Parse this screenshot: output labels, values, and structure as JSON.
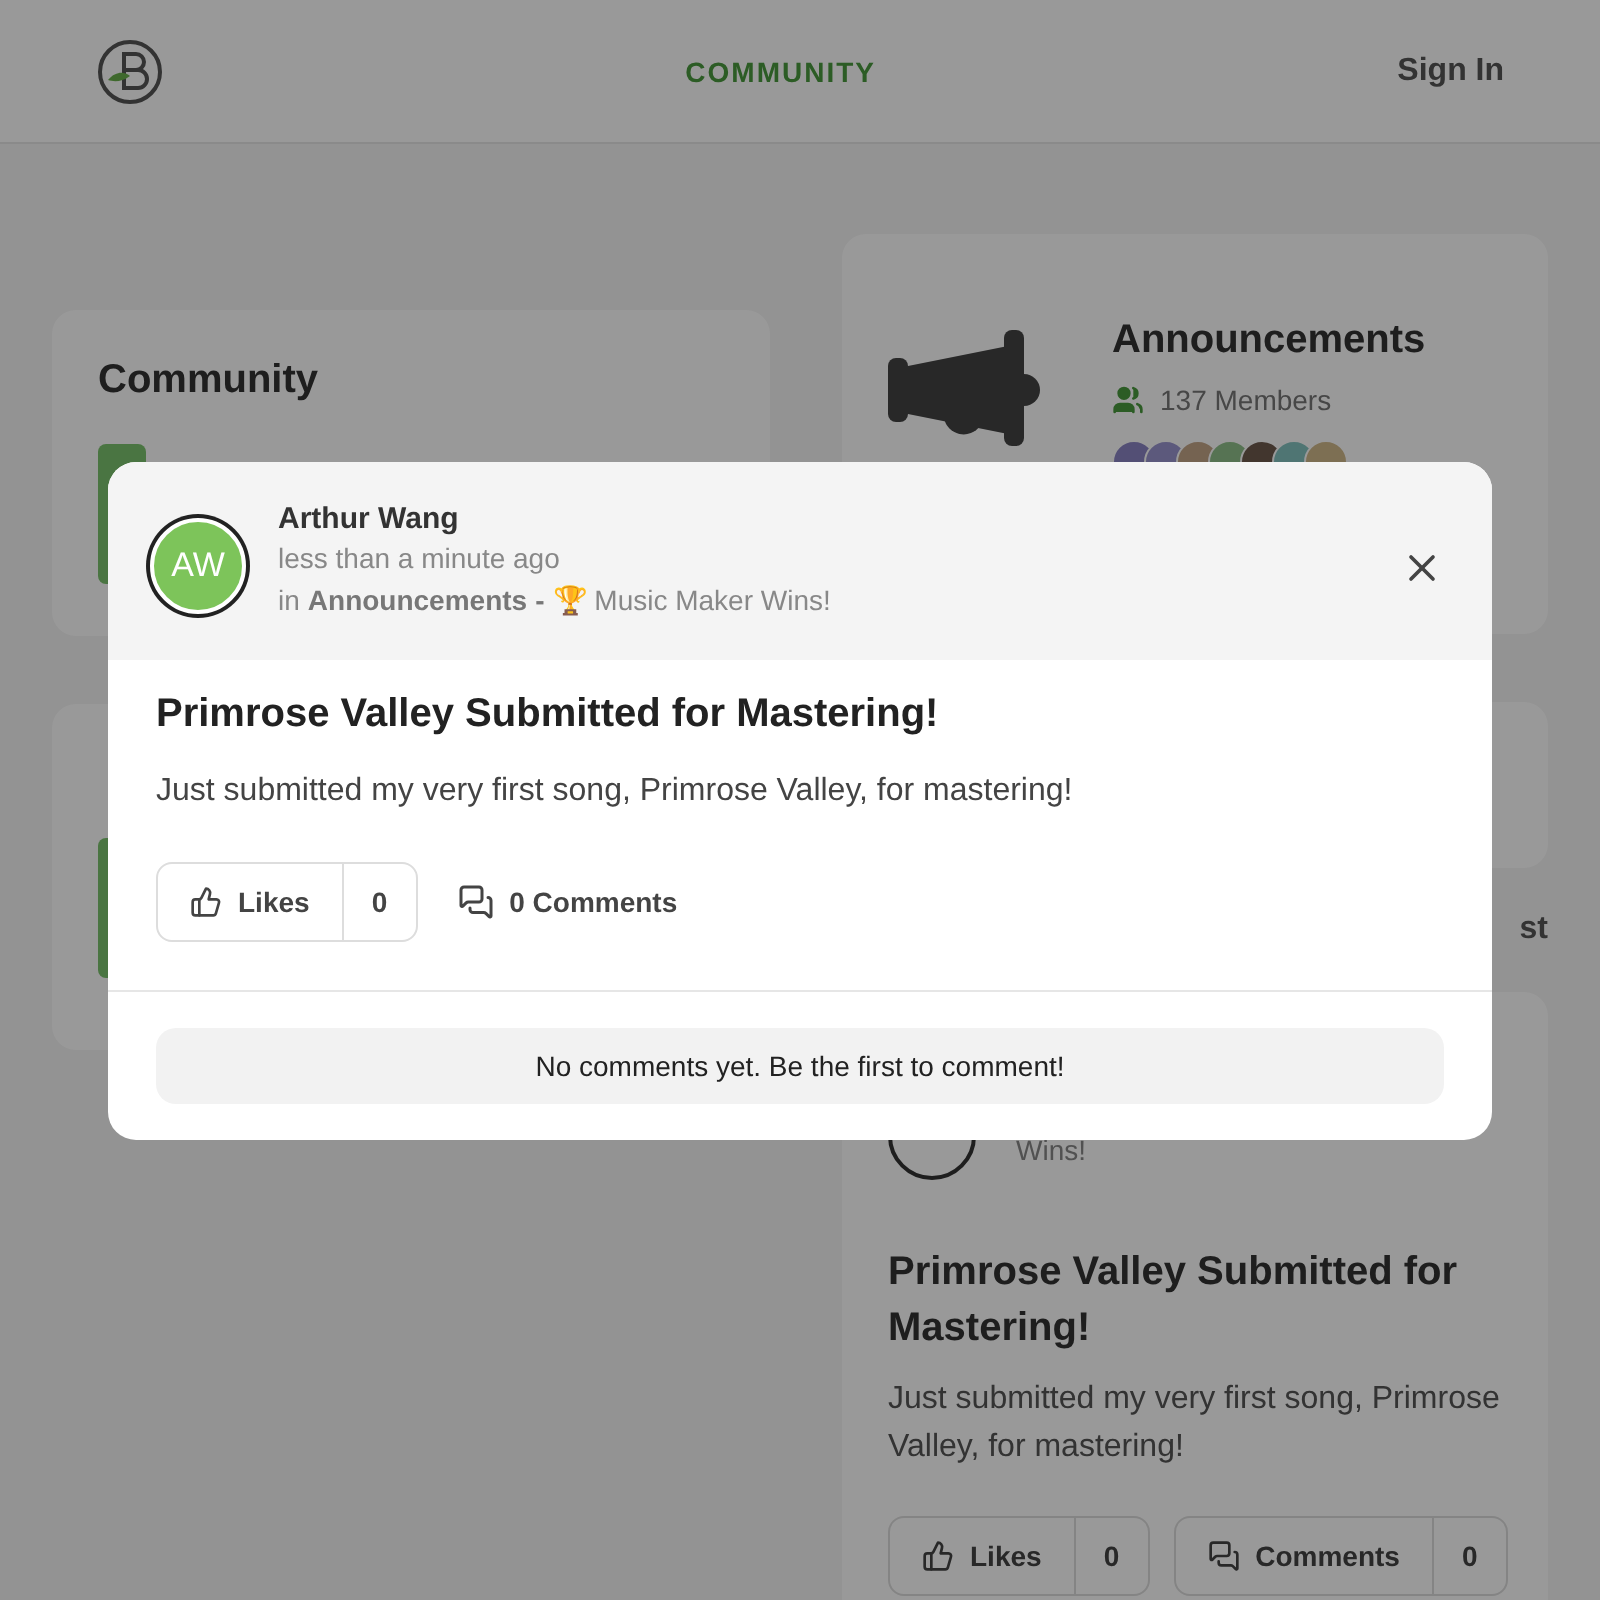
{
  "header": {
    "nav": "COMMUNITY",
    "sign_in": "Sign In"
  },
  "community_card": {
    "title": "Community"
  },
  "group": {
    "title": "Announcements",
    "members": "137 Members"
  },
  "tab_fragment": "st",
  "feed_post": {
    "meta": "Wins!",
    "title": "Primrose Valley Submitted for Mastering!",
    "body": "Just submitted my very first song, Primrose Valley, for mastering!",
    "likes_label": "Likes",
    "likes_count": "0",
    "comments_label": "Comments",
    "comments_count": "0"
  },
  "modal": {
    "initials": "AW",
    "author": "Arthur Wang",
    "time": "less than a minute ago",
    "in_prefix": "in",
    "group": "Announcements",
    "separator": "-",
    "topic": "🏆 Music Maker Wins!",
    "title": "Primrose Valley Submitted for Mastering!",
    "body": "Just submitted my very first song, Primrose Valley, for mastering!",
    "likes_label": "Likes",
    "likes_count": "0",
    "comments": "0 Comments",
    "empty": "No comments yet. Be the first to comment!"
  }
}
